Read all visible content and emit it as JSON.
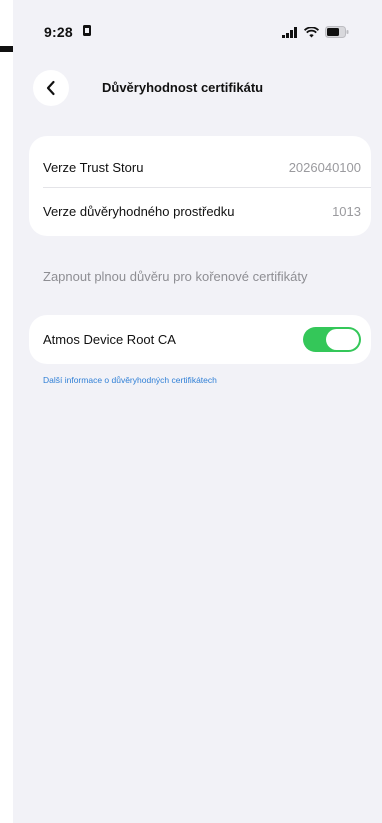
{
  "status_bar": {
    "time": "9:28",
    "icons": [
      "lock-screen-record-icon",
      "cellular-signal-icon",
      "wifi-icon",
      "battery-icon"
    ]
  },
  "nav": {
    "back_icon": "chevron-left-icon",
    "title": "Důvěryhodnost certifikátu"
  },
  "versions": {
    "rows": [
      {
        "label": "Verze Trust Storu",
        "value": "2026040100"
      },
      {
        "label": "Verze důvěryhodného prostředku",
        "value": "1013"
      }
    ]
  },
  "full_trust": {
    "header": "Zapnout plnou důvěru pro kořenové certifikáty",
    "items": [
      {
        "label": "Atmos Device Root CA",
        "enabled": true
      }
    ],
    "info_link": "Další informace o důvěryhodných certifikátech"
  },
  "colors": {
    "background": "#f2f2f7",
    "card": "#ffffff",
    "toggle_on": "#34c759",
    "link": "#2f7fd6",
    "secondary_text": "#8e8e93"
  }
}
